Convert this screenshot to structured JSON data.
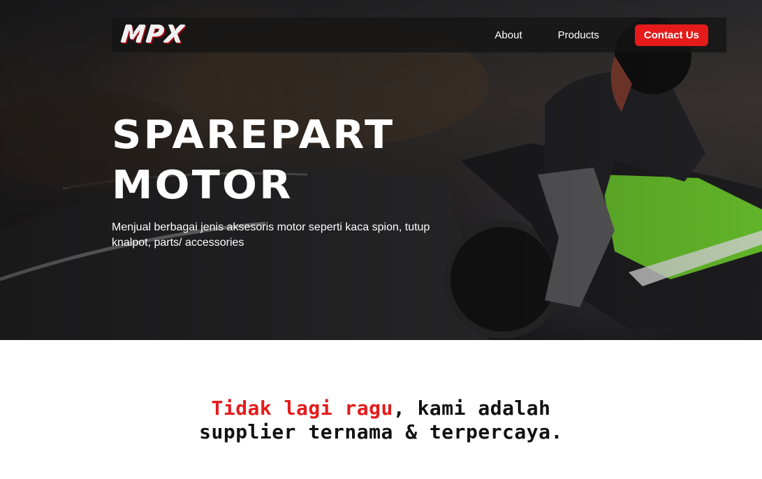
{
  "nav": {
    "logo": "MPX",
    "links": [
      "About",
      "Products"
    ],
    "cta": "Contact Us"
  },
  "hero": {
    "title_line1": "SPAREPART",
    "title_line2": "MOTOR",
    "description": "Menjual berbagai jenis aksesoris motor seperti kaca spion, tutup knalpot, parts/ accessories"
  },
  "tagline": {
    "highlight": "Tidak lagi ragu",
    "line1_rest": ", kami adalah",
    "line2": "supplier ternama & terpercaya."
  },
  "colors": {
    "accent": "#e51b1b",
    "bike_green": "#6fcf2c"
  }
}
